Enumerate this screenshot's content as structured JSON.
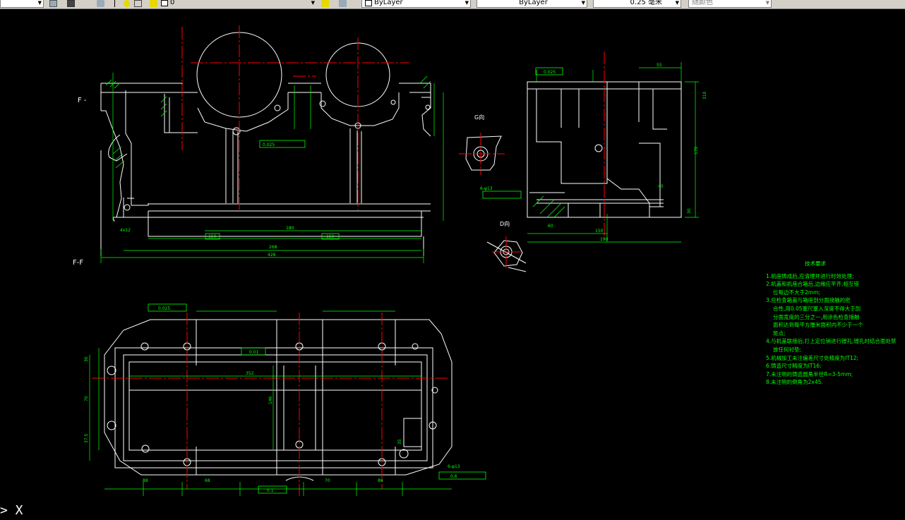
{
  "toolbar": {
    "layer_value": "0",
    "color_value": "ByLayer",
    "linetype_value": "ByLayer",
    "lineweight_value": "0.25 毫米",
    "plotstyle_value": "随颜色"
  },
  "colors": {
    "background": "#000000",
    "outline": "#ffffff",
    "dimension": "#00ff00",
    "center_line": "#ff0000"
  },
  "drawing": {
    "front_section_label": "F -",
    "section_ff_label": "F-F",
    "view_g_label": "G向",
    "view_d_label": "D向",
    "dims_front": [
      "150",
      "150",
      "180",
      "268",
      "428",
      "4x12"
    ],
    "dims_side": [
      "55",
      "60",
      "150",
      "190",
      "310",
      "170",
      "30",
      "40"
    ],
    "dims_top": [
      "352",
      "146",
      "88",
      "68",
      "70",
      "88",
      "30",
      "70",
      "37.5",
      "35"
    ],
    "tolerance_1": "0.025",
    "tolerance_2": "0.025",
    "tolerance_3": "0.01",
    "tolerance_4": "0.1",
    "tolerance_5": "0.6",
    "tolerance_6": "0.025",
    "hole_note_1": "6-φ13",
    "hole_note_2": "6-φ13"
  },
  "tech_requirements": {
    "title": "技术要求",
    "items": [
      "1.机座铸成后,应清理并进行时效处理;",
      "2.机盖和机座合箱后,边缘应平齐,相互错",
      "位每边不大于2mm;",
      "3.应检查箱盖与箱座剖分面接触的密",
      "合性,用0.05塞尺塞入深度不得大于剖",
      "分面宽度的三分之一,用涂色检查接触",
      "面积达到每平方厘米面积内不少于一个",
      "斑点;",
      "4.与机盖联接后,打上定位销进行镗孔,镗孔时结合面处禁",
      "放任何衬垫;",
      "5.机械加工未注偏差尺寸处精度为IT12;",
      "6.铸造尺寸精度为IT16;",
      "7.未注明的铸造圆角半径R=3-5mm;",
      "8.未注明的倒角为2x45."
    ]
  }
}
